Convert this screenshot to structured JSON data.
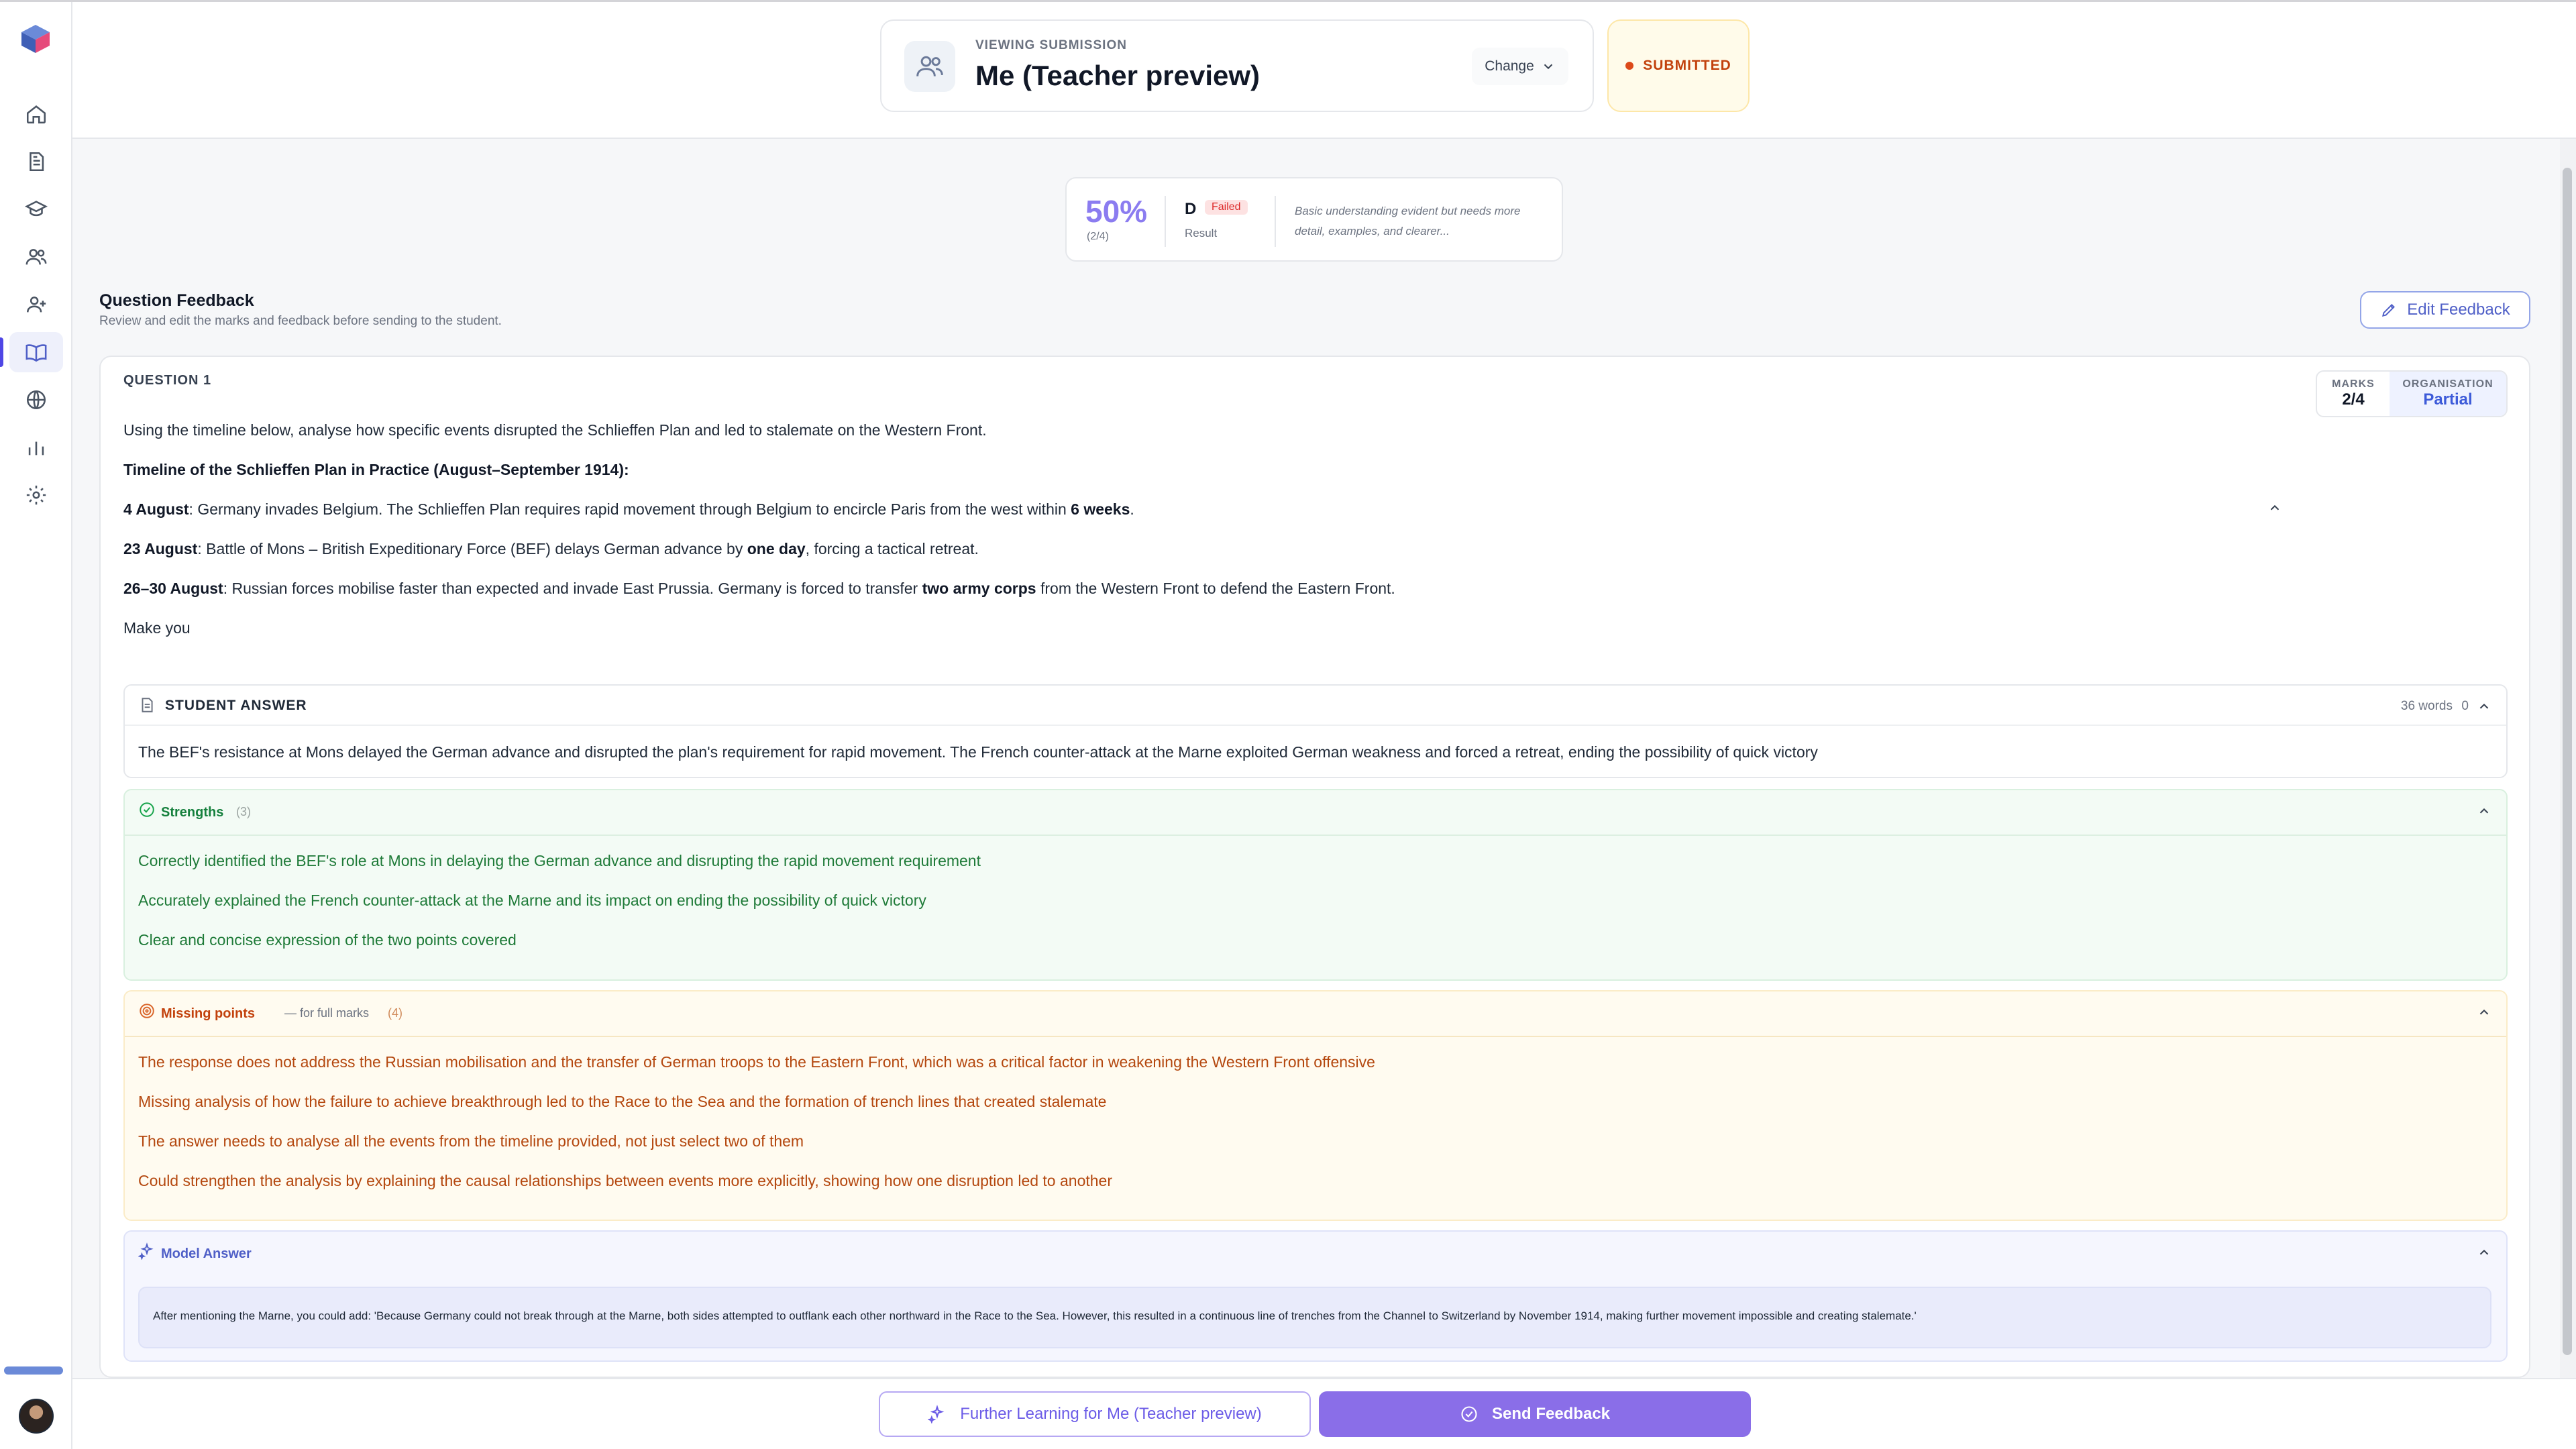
{
  "sidebar": {
    "items": [
      {
        "name": "home-icon"
      },
      {
        "name": "document-icon"
      },
      {
        "name": "graduation-cap-icon"
      },
      {
        "name": "users-icon"
      },
      {
        "name": "user-plus-icon"
      },
      {
        "name": "book-open-icon",
        "active": true
      },
      {
        "name": "globe-icon"
      },
      {
        "name": "bar-chart-icon"
      },
      {
        "name": "settings-icon"
      }
    ]
  },
  "header": {
    "viewing_label": "VIEWING SUBMISSION",
    "viewing_name": "Me (Teacher preview)",
    "change_label": "Change",
    "status": "SUBMITTED"
  },
  "score": {
    "percent": "50%",
    "fraction": "(2/4)",
    "grade": "D",
    "badge": "Failed",
    "result_label": "Result",
    "comment": "Basic understanding evident but needs more detail, examples, and clearer..."
  },
  "feedback": {
    "title": "Question Feedback",
    "subtitle": "Review and edit the marks and feedback before sending to the student.",
    "edit_label": "Edit Feedback"
  },
  "question": {
    "label": "QUESTION 1",
    "marks_label": "MARKS",
    "marks_value": "2/4",
    "org_label": "ORGANISATION",
    "org_value": "Partial",
    "prompt": "Using the timeline below, analyse how specific events disrupted the Schlieffen Plan and led to stalemate on the Western Front.",
    "timeline_heading": "Timeline of the Schlieffen Plan in Practice (August–September 1914):",
    "t1_date": "4 August",
    "t1_text_a": ": Germany invades Belgium. The Schlieffen Plan requires rapid movement through Belgium to encircle Paris from the west within ",
    "t1_bold": "6 weeks",
    "t1_text_b": ".",
    "t2_date": "23 August",
    "t2_text_a": ": Battle of Mons – British Expeditionary Force (BEF) delays German advance by ",
    "t2_bold": "one day",
    "t2_text_b": ", forcing a tactical retreat.",
    "t3_date": "26–30 August",
    "t3_text_a": ": Russian forces mobilise faster than expected and invade East Prussia. Germany is forced to transfer ",
    "t3_bold": "two army corps",
    "t3_text_b": " from the Western Front to defend the Eastern Front.",
    "trailing": "Make you"
  },
  "student_answer": {
    "title": "STUDENT ANSWER",
    "words": "36 words",
    "count": "0",
    "text": "The BEF's resistance at Mons delayed the German advance and disrupted the plan's requirement for rapid movement. The French counter-attack at the Marne exploited German weakness and forced a retreat, ending the possibility of quick victory"
  },
  "strengths": {
    "title": "Strengths",
    "count": "(3)",
    "items": [
      "Correctly identified the BEF's role at Mons in delaying the German advance and disrupting the rapid movement requirement",
      "Accurately explained the French counter-attack at the Marne and its impact on ending the possibility of quick victory",
      "Clear and concise expression of the two points covered"
    ]
  },
  "missing": {
    "title": "Missing points",
    "subtitle": "— for full marks",
    "count": "(4)",
    "items": [
      "The response does not address the Russian mobilisation and the transfer of German troops to the Eastern Front, which was a critical factor in weakening the Western Front offensive",
      "Missing analysis of how the failure to achieve breakthrough led to the Race to the Sea and the formation of trench lines that created stalemate",
      "The answer needs to analyse all the events from the timeline provided, not just select two of them",
      "Could strengthen the analysis by explaining the causal relationships between events more explicitly, showing how one disruption led to another"
    ]
  },
  "model_answer": {
    "title": "Model Answer",
    "text": "After mentioning the Marne, you could add: 'Because Germany could not break through at the Marne, both sides attempted to outflank each other northward in the Race to the Sea. However, this resulted in a continuous line of trenches from the Channel to Switzerland by November 1914, making further movement impossible and creating stalemate.'"
  },
  "bottom": {
    "further_label": "Further Learning for Me (Teacher preview)",
    "send_label": "Send Feedback"
  },
  "colors": {
    "accent": "#8a6ee8",
    "primary_blue": "#4f5fc7",
    "success": "#15803d",
    "warning": "#c2410c",
    "danger": "#dc2626"
  }
}
